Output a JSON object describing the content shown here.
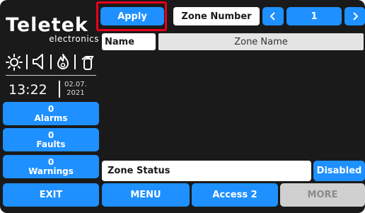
{
  "logo": {
    "brand": "Teletek",
    "subtitle": "electronics"
  },
  "status_icons": [
    "sun-icon",
    "speaker-icon",
    "fire-icon",
    "fire-extinguisher-icon"
  ],
  "clock": {
    "time": "13:22",
    "date_day_month": "02.07.",
    "date_year": "2021"
  },
  "sidebar": {
    "alarms": {
      "count": "0",
      "label": "Alarms"
    },
    "faults": {
      "count": "0",
      "label": "Faults"
    },
    "warnings": {
      "count": "0",
      "label": "Warnings"
    },
    "exit": "EXIT"
  },
  "toolbar": {
    "apply": "Apply",
    "zone_number_label": "Zone Number",
    "zone_number_value": "1",
    "prev_icon": "chevron-left-icon",
    "next_icon": "chevron-right-icon"
  },
  "name_row": {
    "label": "Name",
    "value": "Zone Name"
  },
  "status_row": {
    "label": "Zone Status",
    "value": "Disabled"
  },
  "bottom_bar": {
    "menu": "MENU",
    "access": "Access 2",
    "more": "MORE"
  },
  "colors": {
    "accent": "#1e90ff",
    "background": "#1a1a1a",
    "highlight": "#e8001c",
    "disabled": "#d0d0d0"
  }
}
